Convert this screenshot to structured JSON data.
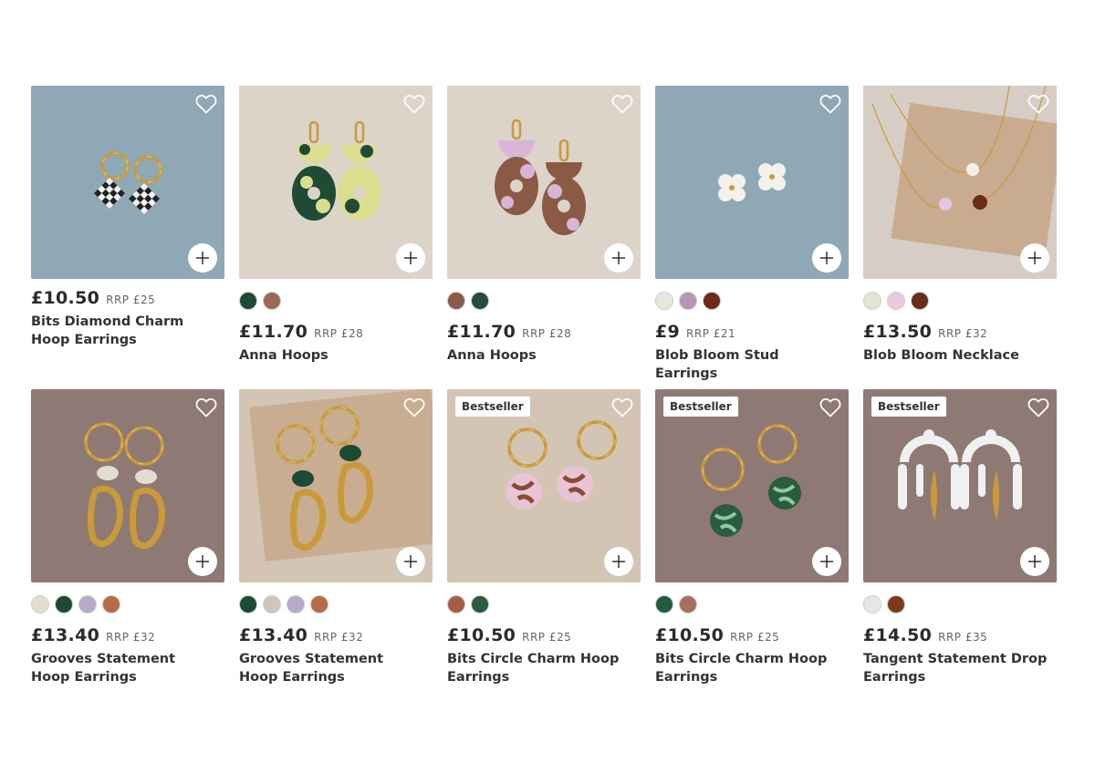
{
  "icons": {
    "wishlist": "heart-outline-icon",
    "add": "plus-icon"
  },
  "products": [
    {
      "price": "£10.50",
      "rrp": "RRP £25",
      "name": "Bits Diamond Charm Hoop Earrings",
      "badge": "",
      "bg": "#8fa8b5",
      "swatches": [],
      "art": "checker-hoops"
    },
    {
      "price": "£11.70",
      "rrp": "RRP £28",
      "name": "Anna Hoops",
      "badge": "",
      "bg": "#dcd3c9",
      "swatches": [
        "#1f4a33",
        "#9b6a55"
      ],
      "art": "anna-green"
    },
    {
      "price": "£11.70",
      "rrp": "RRP £28",
      "name": "Anna Hoops",
      "badge": "",
      "bg": "#dcd3c9",
      "swatches": [
        "#8a5a4a",
        "#244d3a"
      ],
      "art": "anna-brown"
    },
    {
      "price": "£9",
      "rrp": "RRP £21",
      "name": "Blob Bloom Stud Earrings",
      "badge": "",
      "bg": "#8fa8b5",
      "swatches": [
        "#e9e7dc",
        "#b597b8",
        "#6b2a1a"
      ],
      "art": "bloom-studs"
    },
    {
      "price": "£13.50",
      "rrp": "RRP £32",
      "name": "Blob Bloom Necklace",
      "badge": "",
      "bg": "#d6cdc4",
      "swatches": [
        "#e5e2d6",
        "#e9c9de",
        "#6b2c1a"
      ],
      "art": "bloom-necklace"
    },
    {
      "price": "£13.40",
      "rrp": "RRP £32",
      "name": "Grooves Statement Hoop Earrings",
      "badge": "",
      "bg": "#8f7975",
      "swatches": [
        "#e3ddd0",
        "#1d4a32",
        "#b7a9c9",
        "#b46c49"
      ],
      "art": "grooves-a"
    },
    {
      "price": "£13.40",
      "rrp": "RRP £32",
      "name": "Grooves Statement Hoop Earrings",
      "badge": "",
      "bg": "#d3c4b4",
      "swatches": [
        "#1d4a32",
        "#cfc6b8",
        "#b7a9c9",
        "#b46c49"
      ],
      "art": "grooves-b"
    },
    {
      "price": "£10.50",
      "rrp": "RRP £25",
      "name": "Bits Circle Charm Hoop Earrings",
      "badge": "Bestseller",
      "bg": "#d3c4b4",
      "swatches": [
        "#a45e48",
        "#2b5c3f"
      ],
      "art": "circle-pink"
    },
    {
      "price": "£10.50",
      "rrp": "RRP £25",
      "name": "Bits Circle Charm Hoop Earrings",
      "badge": "Bestseller",
      "bg": "#8f7975",
      "swatches": [
        "#245b3f",
        "#a86e5e"
      ],
      "art": "circle-green"
    },
    {
      "price": "£14.50",
      "rrp": "RRP £35",
      "name": "Tangent Statement Drop Earrings",
      "badge": "Bestseller",
      "bg": "#8f7975",
      "swatches": [
        "#e4e6ea",
        "#7a3a1c"
      ],
      "art": "tangent"
    }
  ]
}
